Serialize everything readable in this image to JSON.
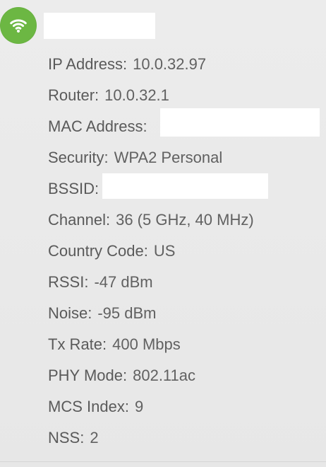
{
  "network": {
    "icon": "wifi-icon",
    "icon_color": "#6cb743"
  },
  "details": [
    {
      "label": "IP Address:",
      "value": "10.0.32.97"
    },
    {
      "label": "Router:",
      "value": "10.0.32.1"
    },
    {
      "label": "MAC Address:",
      "value": ""
    },
    {
      "label": "Security:",
      "value": "WPA2 Personal"
    },
    {
      "label": "BSSID:",
      "value": ""
    },
    {
      "label": "Channel:",
      "value": "36 (5 GHz, 40 MHz)"
    },
    {
      "label": "Country Code:",
      "value": "US"
    },
    {
      "label": "RSSI:",
      "value": "-47 dBm"
    },
    {
      "label": "Noise:",
      "value": "-95 dBm"
    },
    {
      "label": "Tx Rate:",
      "value": "400 Mbps"
    },
    {
      "label": "PHY Mode:",
      "value": "802.11ac"
    },
    {
      "label": "MCS Index:",
      "value": "9"
    },
    {
      "label": "NSS:",
      "value": "2"
    }
  ]
}
